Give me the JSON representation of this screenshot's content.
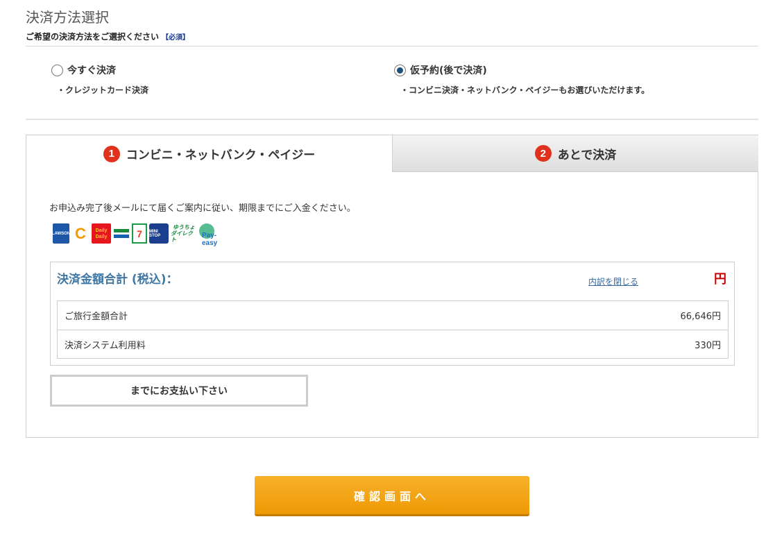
{
  "header": {
    "title": "決済方法選択",
    "subtitle": "ご希望の決済方法をご選択ください",
    "required": "【必須】"
  },
  "options": [
    {
      "label": "今すぐ決済",
      "desc": "・クレジットカード決済",
      "checked": false
    },
    {
      "label": "仮予約(後で決済)",
      "desc": "・コンビニ決済・ネットバンク・ペイジーもお選びいただけます。",
      "checked": true
    }
  ],
  "tabs": [
    {
      "num": "1",
      "label": "コンビニ・ネットバンク・ペイジー",
      "active": true
    },
    {
      "num": "2",
      "label": "あとで決済",
      "active": false
    }
  ],
  "instruction": "お申込み完了後メールにて届くご案内に従い、期限までにご入金ください。",
  "logos": [
    {
      "name": "lawson-logo",
      "text": "LAWSON"
    },
    {
      "name": "circle-k-logo",
      "text": "C"
    },
    {
      "name": "daily-yamazaki-logo",
      "text1": "Daily",
      "text2": "Daily"
    },
    {
      "name": "familymart-logo"
    },
    {
      "name": "seven-eleven-logo",
      "text": "7"
    },
    {
      "name": "ministop-logo",
      "text": "MINI STOP"
    },
    {
      "name": "yucho-direct-logo",
      "text1": "ゆうちょ",
      "text2": "ダイレクト"
    },
    {
      "name": "pay-easy-logo",
      "text": "Pay-easy"
    }
  ],
  "summary": {
    "title": "決済金額合計 (税込)：",
    "toggle_link": "内訳を閉じる",
    "total_suffix": "円",
    "rows": [
      {
        "label": "ご旅行金額合計",
        "value": "66,646円"
      },
      {
        "label": "決済システム利用料",
        "value": "330円"
      }
    ]
  },
  "deadline": "までにお支払い下さい",
  "confirm_button": "確認画面へ",
  "colors": {
    "accent_orange": "#ee9a05",
    "summary_title": "#3f77a5",
    "total_red": "#c90000",
    "tab_number": "#e0311d",
    "radio_checked": "#1d4f7a"
  }
}
